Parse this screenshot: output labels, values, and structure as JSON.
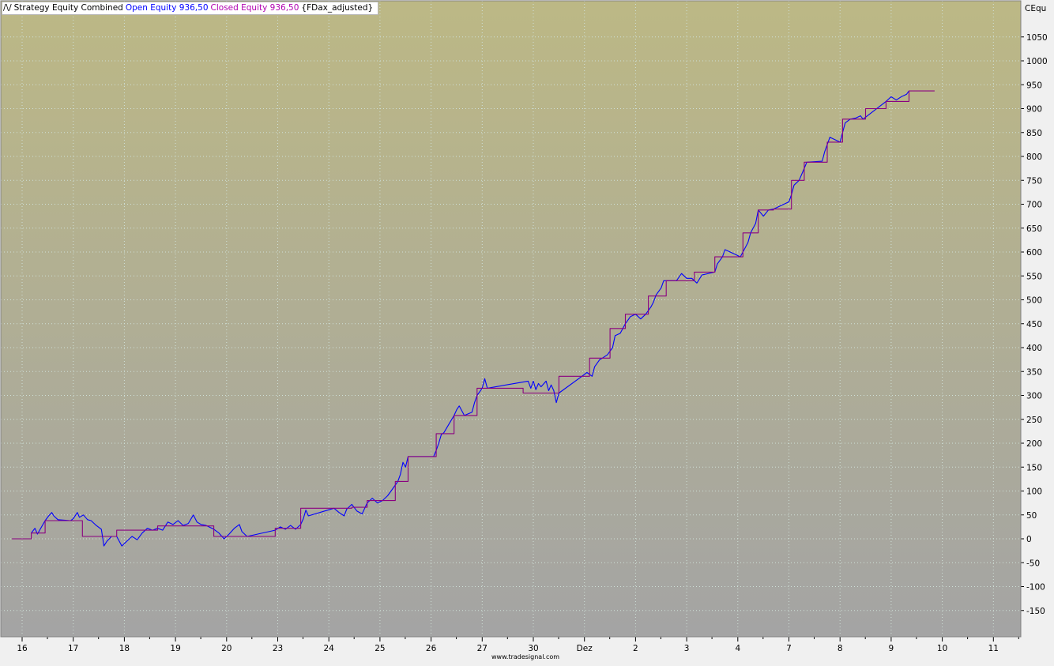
{
  "legend": {
    "icon": "line-chart-icon",
    "icon_glyph": "/\\/",
    "indicator": "Strategy Equity Combined",
    "open_label": "Open Equity 936,50",
    "closed_label": "Closed Equity 936,50",
    "symbol_label": "{FDax_adjusted}",
    "open_color": "#0000ff",
    "closed_color": "#b000b0"
  },
  "axis_title": "CEqu",
  "footer_text": "www.tradesignal.com",
  "colors": {
    "bg_top": "#bcb885",
    "bg_bottom": "#a4a4a4",
    "grid": "#cfe0d8",
    "open_line": "#0000ff",
    "closed_line": "#8b0080"
  },
  "chart_data": {
    "type": "line",
    "title": "",
    "xlabel": "",
    "ylabel": "CEqu",
    "ylim": [
      -200,
      1110
    ],
    "y_ticks": [
      -150,
      -100,
      -50,
      0,
      50,
      100,
      150,
      200,
      250,
      300,
      350,
      400,
      450,
      500,
      550,
      600,
      650,
      700,
      750,
      800,
      850,
      900,
      950,
      1000,
      1050
    ],
    "x_ticks": [
      "16",
      "17",
      "18",
      "19",
      "20",
      "23",
      "24",
      "25",
      "26",
      "27",
      "30",
      "Dez",
      "2",
      "3",
      "4",
      "7",
      "8",
      "9",
      "10",
      "11"
    ],
    "x_domain": [
      -0.2,
      19.85
    ],
    "grid": true,
    "series": [
      {
        "name": "Closed Equity",
        "step": true,
        "points": [
          [
            -0.2,
            0
          ],
          [
            0.18,
            0
          ],
          [
            0.18,
            12
          ],
          [
            0.45,
            12
          ],
          [
            0.45,
            38
          ],
          [
            1.18,
            38
          ],
          [
            1.18,
            5
          ],
          [
            1.85,
            5
          ],
          [
            1.85,
            18
          ],
          [
            2.65,
            18
          ],
          [
            2.65,
            27
          ],
          [
            3.75,
            27
          ],
          [
            3.75,
            5
          ],
          [
            4.95,
            5
          ],
          [
            4.95,
            22
          ],
          [
            5.45,
            22
          ],
          [
            5.45,
            64
          ],
          [
            6.45,
            64
          ],
          [
            6.45,
            66
          ],
          [
            6.75,
            66
          ],
          [
            6.75,
            80
          ],
          [
            7.3,
            80
          ],
          [
            7.3,
            120
          ],
          [
            7.55,
            120
          ],
          [
            7.55,
            172
          ],
          [
            8.1,
            172
          ],
          [
            8.1,
            220
          ],
          [
            8.45,
            220
          ],
          [
            8.45,
            258
          ],
          [
            8.9,
            258
          ],
          [
            8.9,
            315
          ],
          [
            9.8,
            315
          ],
          [
            9.8,
            305
          ],
          [
            10.5,
            305
          ],
          [
            10.5,
            340
          ],
          [
            11.1,
            340
          ],
          [
            11.1,
            378
          ],
          [
            11.5,
            378
          ],
          [
            11.5,
            440
          ],
          [
            11.8,
            440
          ],
          [
            11.8,
            470
          ],
          [
            12.25,
            470
          ],
          [
            12.25,
            508
          ],
          [
            12.6,
            508
          ],
          [
            12.6,
            540
          ],
          [
            13.15,
            540
          ],
          [
            13.15,
            558
          ],
          [
            13.55,
            558
          ],
          [
            13.55,
            590
          ],
          [
            14.1,
            590
          ],
          [
            14.1,
            640
          ],
          [
            14.4,
            640
          ],
          [
            14.4,
            688
          ],
          [
            14.7,
            688
          ],
          [
            14.7,
            690
          ],
          [
            15.05,
            690
          ],
          [
            15.05,
            750
          ],
          [
            15.3,
            750
          ],
          [
            15.3,
            788
          ],
          [
            15.75,
            788
          ],
          [
            15.75,
            830
          ],
          [
            16.05,
            830
          ],
          [
            16.05,
            878
          ],
          [
            16.5,
            878
          ],
          [
            16.5,
            900
          ],
          [
            16.9,
            900
          ],
          [
            16.9,
            915
          ],
          [
            17.35,
            915
          ],
          [
            17.35,
            937
          ],
          [
            17.85,
            937
          ]
        ]
      },
      {
        "name": "Open Equity",
        "step": false,
        "points": [
          [
            0.18,
            12
          ],
          [
            0.25,
            22
          ],
          [
            0.3,
            10
          ],
          [
            0.45,
            38
          ],
          [
            0.52,
            48
          ],
          [
            0.58,
            55
          ],
          [
            0.62,
            48
          ],
          [
            0.7,
            40
          ],
          [
            0.95,
            38
          ],
          [
            1.0,
            42
          ],
          [
            1.08,
            55
          ],
          [
            1.12,
            45
          ],
          [
            1.2,
            50
          ],
          [
            1.28,
            40
          ],
          [
            1.35,
            38
          ],
          [
            1.45,
            28
          ],
          [
            1.55,
            20
          ],
          [
            1.6,
            -15
          ],
          [
            1.66,
            -5
          ],
          [
            1.75,
            5
          ],
          [
            1.85,
            5
          ],
          [
            1.95,
            -15
          ],
          [
            2.05,
            -5
          ],
          [
            2.15,
            5
          ],
          [
            2.25,
            -2
          ],
          [
            2.35,
            12
          ],
          [
            2.45,
            22
          ],
          [
            2.55,
            18
          ],
          [
            2.65,
            22
          ],
          [
            2.75,
            18
          ],
          [
            2.85,
            35
          ],
          [
            2.95,
            30
          ],
          [
            3.05,
            38
          ],
          [
            3.15,
            28
          ],
          [
            3.25,
            32
          ],
          [
            3.35,
            50
          ],
          [
            3.42,
            35
          ],
          [
            3.5,
            30
          ],
          [
            3.6,
            28
          ],
          [
            3.75,
            20
          ],
          [
            3.85,
            12
          ],
          [
            3.95,
            0
          ],
          [
            4.05,
            10
          ],
          [
            4.15,
            22
          ],
          [
            4.25,
            30
          ],
          [
            4.3,
            15
          ],
          [
            4.4,
            5
          ],
          [
            4.95,
            18
          ],
          [
            5.05,
            25
          ],
          [
            5.15,
            20
          ],
          [
            5.25,
            28
          ],
          [
            5.35,
            20
          ],
          [
            5.45,
            30
          ],
          [
            5.5,
            42
          ],
          [
            5.55,
            60
          ],
          [
            5.6,
            48
          ],
          [
            6.1,
            64
          ],
          [
            6.2,
            55
          ],
          [
            6.3,
            48
          ],
          [
            6.35,
            62
          ],
          [
            6.45,
            72
          ],
          [
            6.55,
            58
          ],
          [
            6.65,
            52
          ],
          [
            6.75,
            75
          ],
          [
            6.85,
            85
          ],
          [
            6.95,
            75
          ],
          [
            7.05,
            80
          ],
          [
            7.15,
            90
          ],
          [
            7.25,
            105
          ],
          [
            7.35,
            120
          ],
          [
            7.4,
            135
          ],
          [
            7.45,
            160
          ],
          [
            7.5,
            150
          ],
          [
            7.55,
            172
          ],
          [
            8.05,
            172
          ],
          [
            8.1,
            185
          ],
          [
            8.15,
            200
          ],
          [
            8.2,
            218
          ],
          [
            8.25,
            222
          ],
          [
            8.35,
            240
          ],
          [
            8.45,
            258
          ],
          [
            8.5,
            270
          ],
          [
            8.55,
            278
          ],
          [
            8.65,
            258
          ],
          [
            8.8,
            265
          ],
          [
            8.85,
            285
          ],
          [
            8.9,
            300
          ],
          [
            9.0,
            315
          ],
          [
            9.05,
            335
          ],
          [
            9.1,
            315
          ],
          [
            9.9,
            330
          ],
          [
            9.95,
            315
          ],
          [
            10.0,
            330
          ],
          [
            10.05,
            312
          ],
          [
            10.1,
            325
          ],
          [
            10.15,
            318
          ],
          [
            10.25,
            330
          ],
          [
            10.3,
            310
          ],
          [
            10.35,
            322
          ],
          [
            10.4,
            310
          ],
          [
            10.45,
            285
          ],
          [
            10.5,
            305
          ],
          [
            10.95,
            340
          ],
          [
            11.05,
            348
          ],
          [
            11.15,
            340
          ],
          [
            11.2,
            360
          ],
          [
            11.3,
            375
          ],
          [
            11.35,
            378
          ],
          [
            11.45,
            385
          ],
          [
            11.55,
            400
          ],
          [
            11.6,
            425
          ],
          [
            11.7,
            430
          ],
          [
            11.8,
            450
          ],
          [
            11.9,
            465
          ],
          [
            12.0,
            470
          ],
          [
            12.1,
            460
          ],
          [
            12.2,
            470
          ],
          [
            12.3,
            485
          ],
          [
            12.35,
            495
          ],
          [
            12.4,
            510
          ],
          [
            12.5,
            525
          ],
          [
            12.55,
            540
          ],
          [
            12.8,
            540
          ],
          [
            12.9,
            555
          ],
          [
            13.0,
            545
          ],
          [
            13.1,
            545
          ],
          [
            13.2,
            535
          ],
          [
            13.3,
            552
          ],
          [
            13.55,
            558
          ],
          [
            13.6,
            575
          ],
          [
            13.7,
            590
          ],
          [
            13.75,
            605
          ],
          [
            13.85,
            600
          ],
          [
            13.95,
            595
          ],
          [
            14.05,
            590
          ],
          [
            14.1,
            600
          ],
          [
            14.2,
            620
          ],
          [
            14.25,
            640
          ],
          [
            14.35,
            660
          ],
          [
            14.4,
            688
          ],
          [
            14.5,
            675
          ],
          [
            14.6,
            688
          ],
          [
            14.7,
            690
          ],
          [
            15.0,
            705
          ],
          [
            15.05,
            720
          ],
          [
            15.1,
            740
          ],
          [
            15.2,
            750
          ],
          [
            15.3,
            775
          ],
          [
            15.35,
            788
          ],
          [
            15.65,
            790
          ],
          [
            15.7,
            810
          ],
          [
            15.8,
            840
          ],
          [
            15.9,
            835
          ],
          [
            16.0,
            830
          ],
          [
            16.05,
            850
          ],
          [
            16.1,
            870
          ],
          [
            16.2,
            878
          ],
          [
            16.3,
            880
          ],
          [
            16.4,
            885
          ],
          [
            16.45,
            878
          ],
          [
            16.9,
            915
          ],
          [
            17.0,
            925
          ],
          [
            17.1,
            918
          ],
          [
            17.2,
            925
          ],
          [
            17.3,
            930
          ],
          [
            17.35,
            937
          ]
        ]
      }
    ]
  }
}
